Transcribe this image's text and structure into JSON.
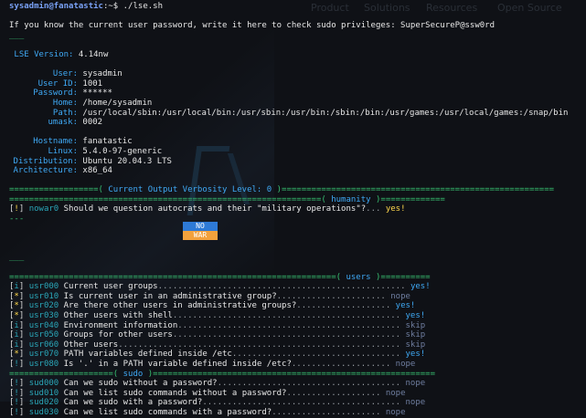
{
  "terminal": {
    "prompt_user": "sysadmin@fanatastic",
    "prompt_sep": ":~$ ",
    "command": "./lse.sh",
    "password_hint": "If you know the current user password, write it here to check sudo privileges: SuperSecureP@ssw0rd",
    "lse_version_label": "LSE Version:",
    "lse_version": "4.14nw"
  },
  "user_info": [
    {
      "key": "User:",
      "value": "sysadmin"
    },
    {
      "key": "User ID:",
      "value": "1001"
    },
    {
      "key": "Password:",
      "value": "******"
    },
    {
      "key": "Home:",
      "value": "/home/sysadmin"
    },
    {
      "key": "Path:",
      "value": "/usr/local/sbin:/usr/local/bin:/usr/sbin:/usr/bin:/sbin:/bin:/usr/games:/usr/local/games:/snap/bin"
    },
    {
      "key": "umask:",
      "value": "0002"
    }
  ],
  "system_info": [
    {
      "key": "Hostname:",
      "value": "fanatastic"
    },
    {
      "key": "Linux:",
      "value": "5.4.0-97-generic"
    },
    {
      "key": "Distribution:",
      "value": "Ubuntu 20.04.3 LTS"
    },
    {
      "key": "Architecture:",
      "value": "x86_64"
    }
  ],
  "verbosity": {
    "left_rule": "==================( ",
    "label": "Current Output Verbosity Level: 0",
    "right_rule": " )======================================================="
  },
  "sections": {
    "humanity": {
      "rule_left": "===============================================================( ",
      "name": "humanity",
      "rule_right": " )=============",
      "checks": [
        {
          "mark": "!",
          "id": "nowar0",
          "text": "Should we question autocrats and their \"military operations\"?",
          "dots": "...",
          "result": "yes!"
        }
      ]
    },
    "users": {
      "rule_left": "==================================================================( ",
      "name": "users",
      "rule_right": " )==========",
      "checks": [
        {
          "mark": "i",
          "id": "usr000",
          "text": "Current user groups",
          "dots": "..................................................",
          "result": "yes!"
        },
        {
          "mark": "*",
          "id": "usr010",
          "text": "Is current user in an administrative group?",
          "dots": "......................",
          "result": "nope"
        },
        {
          "mark": "*",
          "id": "usr020",
          "text": "Are there other users in administrative groups?",
          "dots": "...................",
          "result": "yes!"
        },
        {
          "mark": "*",
          "id": "usr030",
          "text": "Other users with shell",
          "dots": "..............................................",
          "result": "yes!"
        },
        {
          "mark": "i",
          "id": "usr040",
          "text": "Environment information",
          "dots": ".............................................",
          "result": "skip"
        },
        {
          "mark": "i",
          "id": "usr050",
          "text": "Groups for other users",
          "dots": "..............................................",
          "result": "skip"
        },
        {
          "mark": "i",
          "id": "usr060",
          "text": "Other users",
          "dots": ".........................................................",
          "result": "skip"
        },
        {
          "mark": "*",
          "id": "usr070",
          "text": "PATH variables defined inside /etc",
          "dots": "..................................",
          "result": "yes!"
        },
        {
          "mark": "!",
          "id": "usr080",
          "text": "Is '.' in a PATH variable defined inside /etc?",
          "dots": "....................",
          "result": "nope"
        }
      ]
    },
    "sudo": {
      "rule_left": "=====================( ",
      "name": "sudo",
      "rule_right": " )=========================================================",
      "checks": [
        {
          "mark": "!",
          "id": "sud000",
          "text": "Can we sudo without a password?",
          "dots": ".....................................",
          "result": "nope"
        },
        {
          "mark": "!",
          "id": "sud010",
          "text": "Can we list sudo commands without a password?",
          "dots": "...................",
          "result": "nope"
        },
        {
          "mark": "!",
          "id": "sud020",
          "text": "Can we sudo with a password?",
          "dots": "........................................",
          "result": "nope"
        },
        {
          "mark": "!",
          "id": "sud030",
          "text": "Can we list sudo commands with a password?",
          "dots": "......................",
          "result": "nope"
        }
      ]
    }
  },
  "menu": {
    "options": [
      "NO",
      "WAR"
    ]
  },
  "background_page": {
    "items": [
      "Product",
      "Solutions",
      "Resources",
      "Open Source"
    ]
  },
  "colors": {
    "background": "#0f1116",
    "accent_blue": "#3fa9f5",
    "rule_green": "#38c172",
    "mark_yellow": "#ffd84d",
    "menu_no": "#2e7ad6",
    "menu_war": "#f2a13c"
  }
}
